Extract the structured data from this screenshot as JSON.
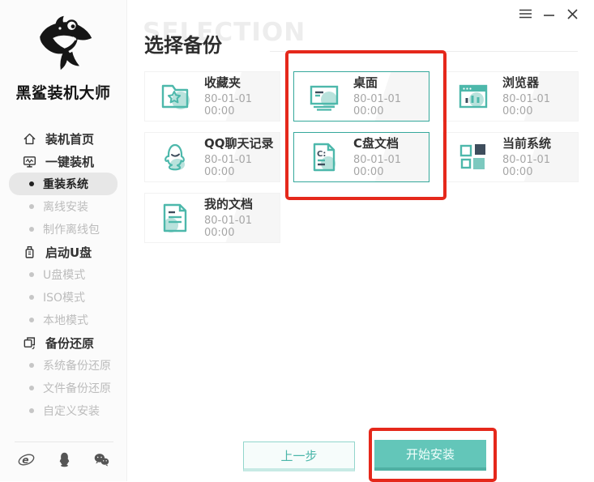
{
  "brand": {
    "name": "黑鲨装机大师"
  },
  "sidebar": {
    "menu": [
      {
        "label": "装机首页",
        "type": "parent",
        "icon": "home-icon",
        "selected": false
      },
      {
        "label": "一键装机",
        "type": "parent",
        "icon": "one-key-icon",
        "selected": false
      },
      {
        "label": "重装系统",
        "type": "sub",
        "selected": true
      },
      {
        "label": "离线安装",
        "type": "sub",
        "selected": false
      },
      {
        "label": "制作离线包",
        "type": "sub",
        "selected": false
      },
      {
        "label": "启动U盘",
        "type": "parent",
        "icon": "usb-icon",
        "selected": false
      },
      {
        "label": "U盘模式",
        "type": "sub",
        "selected": false
      },
      {
        "label": "ISO模式",
        "type": "sub",
        "selected": false
      },
      {
        "label": "本地模式",
        "type": "sub",
        "selected": false
      },
      {
        "label": "备份还原",
        "type": "parent",
        "icon": "restore-icon",
        "selected": false
      },
      {
        "label": "系统备份还原",
        "type": "sub",
        "selected": false
      },
      {
        "label": "文件备份还原",
        "type": "sub",
        "selected": false
      },
      {
        "label": "自定义安装",
        "type": "sub",
        "selected": false
      }
    ],
    "footer_icons": [
      "ie-icon",
      "qq-icon",
      "wechat-icon"
    ]
  },
  "main": {
    "watermark": "SELECTION",
    "title": "选择备份",
    "cards": [
      {
        "title": "收藏夹",
        "date": "80-01-01 00:00",
        "icon": "favorites-icon",
        "selected": false
      },
      {
        "title": "桌面",
        "date": "80-01-01 00:00",
        "icon": "desktop-icon",
        "selected": true
      },
      {
        "title": "浏览器",
        "date": "80-01-01 00:00",
        "icon": "browser-icon",
        "selected": false
      },
      {
        "title": "QQ聊天记录",
        "date": "80-01-01 00:00",
        "icon": "qq-chat-icon",
        "selected": false
      },
      {
        "title": "C盘文档",
        "date": "80-01-01 00:00",
        "icon": "c-drive-doc-icon",
        "selected": true
      },
      {
        "title": "当前系统",
        "date": "80-01-01 00:00",
        "icon": "current-system-icon",
        "selected": false
      },
      {
        "title": "我的文档",
        "date": "80-01-01 00:00",
        "icon": "my-docs-icon",
        "selected": false
      }
    ],
    "buttons": {
      "prev": "上一步",
      "start": "开始安装"
    }
  },
  "colors": {
    "accent": "#4db8ab",
    "accent_dark": "#4fb0a3",
    "accent_light": "#b9e2dc",
    "dark_navy": "#3e4d5c",
    "annotation_red": "#e5281b"
  }
}
